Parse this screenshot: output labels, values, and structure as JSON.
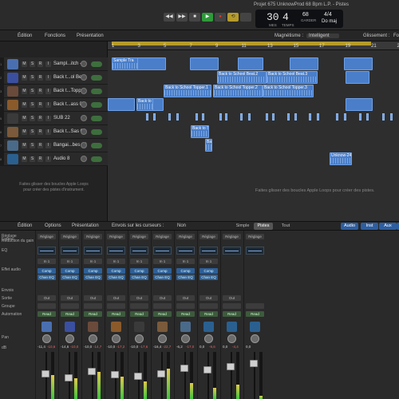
{
  "window": {
    "title": "Projet 675 UnknowProd 68 Bpm L.P. - Pistes"
  },
  "transport": {
    "rewind": "◀◀",
    "forward": "▶▶",
    "stop": "■",
    "play": "▶",
    "record": "●",
    "cycle": "⟲",
    "bar": "30",
    "beat": "4",
    "bar_label": "MES",
    "beat_label": "TEMPS",
    "tempo": "68",
    "tempo_label": "GARDER",
    "signature": "4/4",
    "key": "Do maj"
  },
  "toolbar": {
    "edit": "Édition",
    "functions": "Fonctions",
    "view": "Présentation",
    "snap_label": "Magnétisme :",
    "snap_value": "Intelligent",
    "drag_label": "Glissement :",
    "drag_value": "Fo"
  },
  "tracks": [
    {
      "num": "1",
      "name": "Sampl...itch - 4",
      "color": "#4a6fb0"
    },
    {
      "num": "2",
      "name": "Back t...ol Beat",
      "color": "#3a4fa0"
    },
    {
      "num": "3",
      "name": "Back t...Topper",
      "color": "#6a4a3a"
    },
    {
      "num": "4",
      "name": "Back t...ass 01",
      "color": "#8a5a2a"
    },
    {
      "num": "5",
      "name": "SUB 22",
      "color": "#3a3a3a"
    },
    {
      "num": "6",
      "name": "Back t...Sas 02",
      "color": "#7a5a3a"
    },
    {
      "num": "7",
      "name": "Bangai...bes 03",
      "color": "#4a6a8a"
    },
    {
      "num": "8",
      "name": "Audio 8",
      "color": "#2a6090"
    }
  ],
  "track_buttons": {
    "mute": "M",
    "solo": "S",
    "rec": "R",
    "input": "I"
  },
  "hints": {
    "track_list": "Faites glisser des boucles Apple Loops pour créer des pistes d'instrument.",
    "arrange": "Faites glisser des boucles Apple Loops pour créer des pistes."
  },
  "ruler": [
    "1",
    "3",
    "5",
    "7",
    "9",
    "11",
    "13",
    "15",
    "17",
    "19",
    "21",
    "23"
  ],
  "regions": [
    {
      "label": "Sample Tra",
      "row": 0
    },
    {
      "label": "Back to School Beat.2",
      "row": 1
    },
    {
      "label": "Back to School Beat.3",
      "row": 1
    },
    {
      "label": "Back to School Topper.1",
      "row": 2
    },
    {
      "label": "Back to School Topper.2",
      "row": 2
    },
    {
      "label": "Back to School Topper.3",
      "row": 2
    },
    {
      "label": "Back to Sc",
      "row": 3
    },
    {
      "label": "Back to S",
      "row": 5
    },
    {
      "label": "Bar",
      "row": 6
    },
    {
      "label": "Unknow-24",
      "row": 7
    }
  ],
  "mixer": {
    "edit": "Édition",
    "options": "Options",
    "view": "Présentation",
    "sends_label": "Envois sur les curseurs :",
    "sends_value": "Non",
    "tabs": [
      "Simple",
      "Pistes",
      "Tout"
    ],
    "filters": [
      "Audio",
      "Inst",
      "Aux",
      "B"
    ],
    "row_labels": [
      "Réglage",
      "Réduction du gain",
      "EQ",
      "Entrée",
      "Effet audio",
      "Envois",
      "Sortie",
      "Groupe",
      "Automation",
      "Pan",
      "dB"
    ],
    "strips": [
      {
        "setting": "Réglage",
        "input": "In 1",
        "fx1": "Comp",
        "fx2": "Chan EQ",
        "output": "Out",
        "auto": "Read",
        "db1": "-11,4",
        "db2": "-10,6"
      },
      {
        "setting": "Réglage",
        "input": "In 1",
        "fx1": "Comp",
        "fx2": "Chan EQ",
        "output": "Out",
        "auto": "Read",
        "db1": "-14,6",
        "db2": "-10,0"
      },
      {
        "setting": "Réglage",
        "input": "In 1",
        "fx1": "Comp",
        "fx2": "Chan EQ",
        "output": "Out",
        "auto": "Read",
        "db1": "-10,0",
        "db2": "-14,7"
      },
      {
        "setting": "Réglage",
        "input": "In 1",
        "fx1": "Comp",
        "fx2": "Chan EQ",
        "output": "Out",
        "auto": "Read",
        "db1": "-10,0",
        "db2": "-17,2"
      },
      {
        "setting": "Réglage",
        "input": "In 1",
        "fx1": "Comp",
        "fx2": "Chan EQ",
        "output": "Out",
        "auto": "Read",
        "db1": "-10,0",
        "db2": "-17,6"
      },
      {
        "setting": "Réglage",
        "input": "In 1",
        "fx1": "Comp",
        "fx2": "Chan EQ",
        "output": "Out",
        "auto": "Read",
        "db1": "-16,4",
        "db2": "-22,7"
      },
      {
        "setting": "Réglage",
        "input": "In 1",
        "fx1": "Comp",
        "fx2": "Chan EQ",
        "output": "Out",
        "auto": "Read",
        "db1": "-6,2",
        "db2": "-17,0"
      },
      {
        "setting": "Réglage",
        "input": "In 1",
        "fx1": "Comp",
        "fx2": "Chan EQ",
        "output": "Out",
        "auto": "Read",
        "db1": "0,0",
        "db2": "-9,6"
      },
      {
        "setting": "Réglage",
        "input": "",
        "fx1": "",
        "fx2": "",
        "output": "Out",
        "auto": "Read",
        "db1": "0,0",
        "db2": "-4,4"
      },
      {
        "setting": "Réglage",
        "input": "",
        "fx1": "",
        "fx2": "",
        "output": "",
        "auto": "Read",
        "db1": "0,0",
        "db2": ""
      }
    ]
  }
}
